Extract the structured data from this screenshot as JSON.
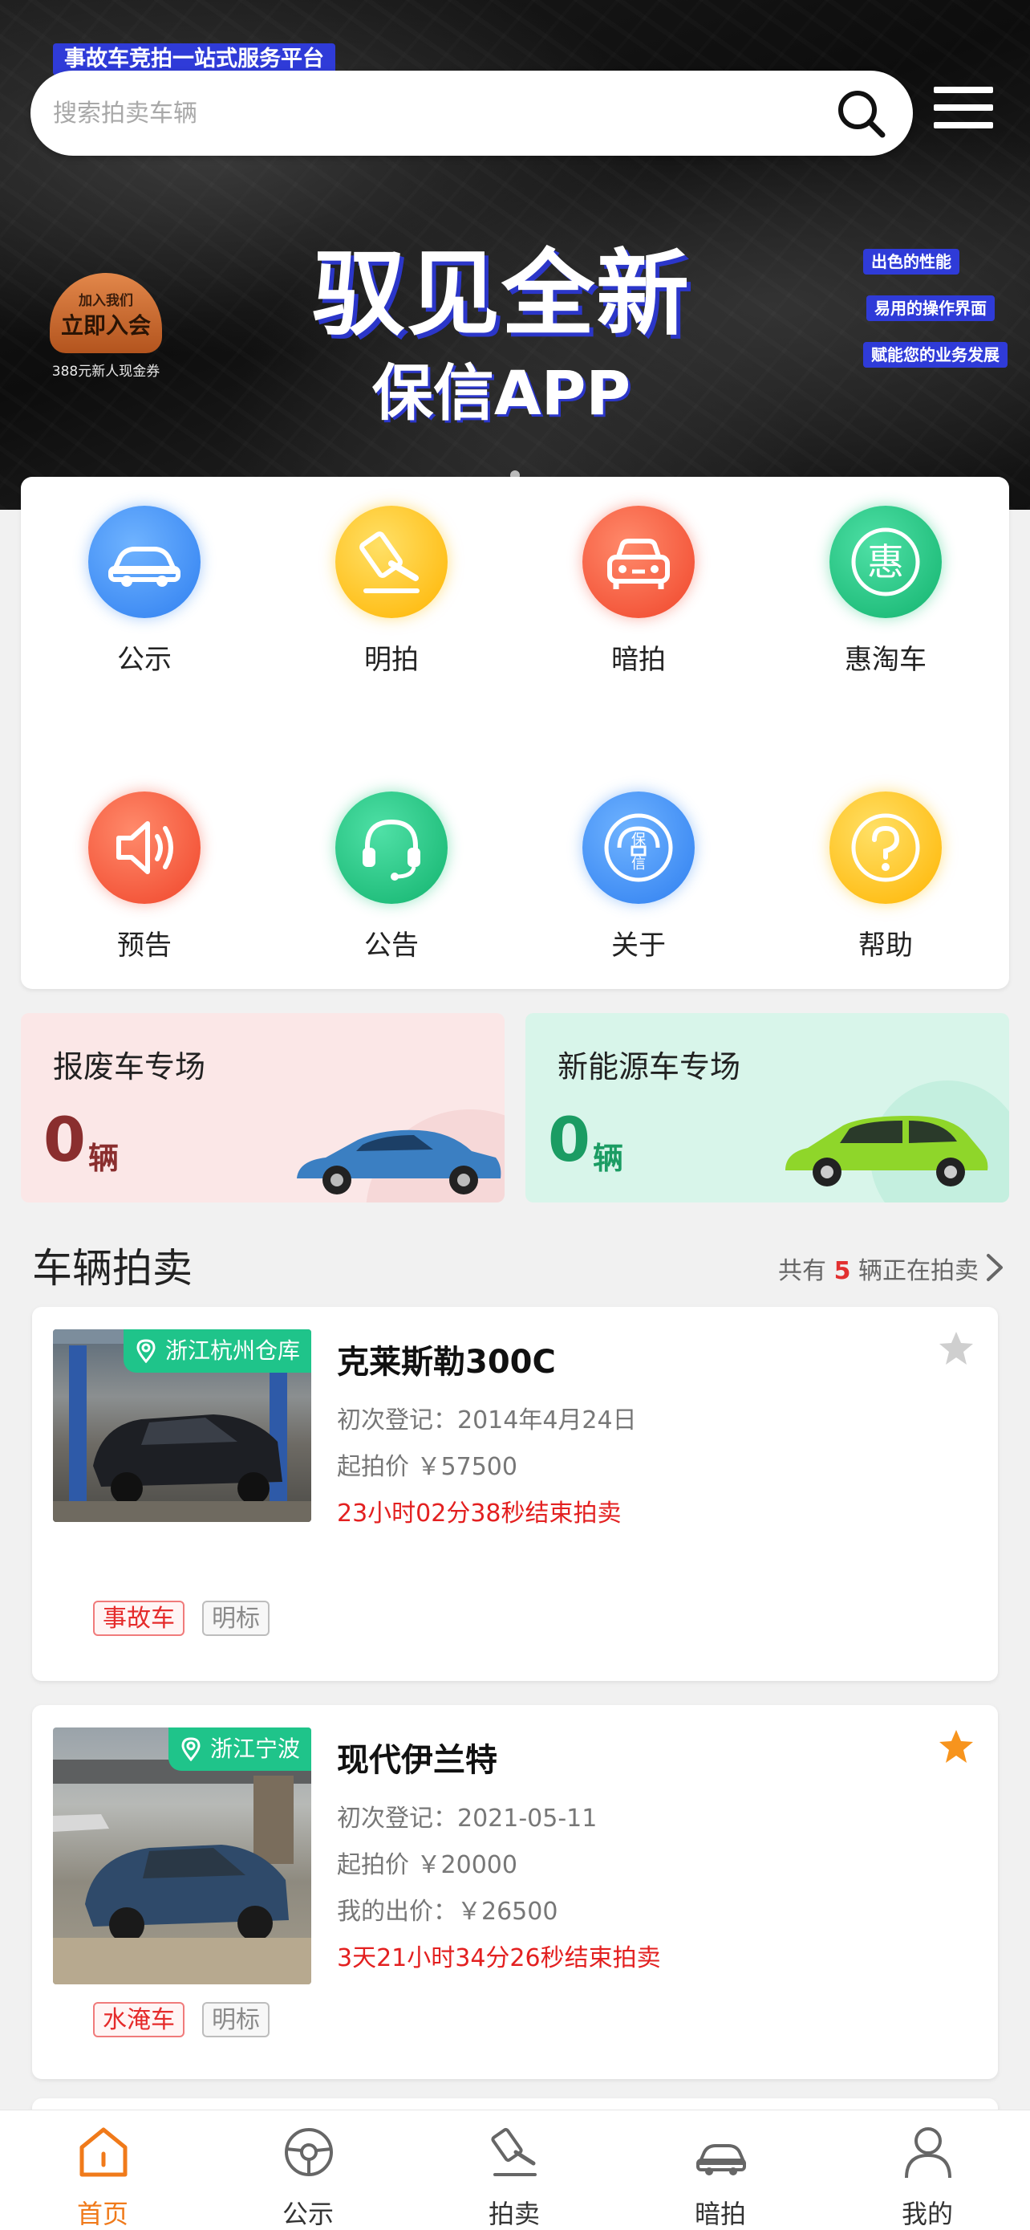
{
  "banner": {
    "tag": "事故车竞拍一站式服务平台",
    "search_placeholder": "搜索拍卖车辆",
    "join_line1": "加入我们",
    "join_line2": "立即入会",
    "join_line3": "388元新人现金券",
    "headline1": "驭见全新",
    "headline2": "保信APP",
    "features": [
      "出色的性能",
      "易用的操作界面",
      "赋能您的业务发展"
    ]
  },
  "categories": [
    {
      "label": "公示",
      "icon": "car-icon",
      "color": "#3d8ff5"
    },
    {
      "label": "明拍",
      "icon": "gavel-icon",
      "color": "#ffc51a"
    },
    {
      "label": "暗拍",
      "icon": "car-front-icon",
      "color": "#f5573e"
    },
    {
      "label": "惠淘车",
      "icon": "hui-icon",
      "color": "#1cc77f"
    },
    {
      "label": "预告",
      "icon": "speaker-icon",
      "color": "#f5573e"
    },
    {
      "label": "公告",
      "icon": "headset-icon",
      "color": "#1cc77f"
    },
    {
      "label": "关于",
      "icon": "baoxin-logo-icon",
      "color": "#3d8ff5"
    },
    {
      "label": "帮助",
      "icon": "question-icon",
      "color": "#ffc51a"
    }
  ],
  "zones": [
    {
      "title": "报废车专场",
      "count": "0",
      "unit": "辆",
      "num_color": "#8a2e2e",
      "bg": "#fbe7e7"
    },
    {
      "title": "新能源车专场",
      "count": "0",
      "unit": "辆",
      "num_color": "#1b9c63",
      "bg": "#d8f5ea"
    }
  ],
  "section": {
    "title": "车辆拍卖",
    "more_prefix": "共有",
    "more_count": "5",
    "more_suffix": "辆正在拍卖"
  },
  "listings": [
    {
      "location": "浙江杭州仓库",
      "name": "克莱斯勒300C",
      "reg": "初次登记：2014年4月24日",
      "start_price": "起拍价 ￥57500",
      "ends": "23小时02分38秒结束拍卖",
      "tags": [
        "事故车",
        "明标"
      ],
      "starred": false
    },
    {
      "location": "浙江宁波",
      "name": "现代伊兰特",
      "reg": "初次登记：2021-05-11",
      "start_price": "起拍价 ￥20000",
      "my_bid": "我的出价：￥26500",
      "ends": "3天21小时34分26秒结束拍卖",
      "tags": [
        "水淹车",
        "明标"
      ],
      "starred": true
    }
  ],
  "tabs": [
    {
      "label": "首页",
      "icon": "home-icon",
      "active": true
    },
    {
      "label": "公示",
      "icon": "steering-wheel-icon",
      "active": false
    },
    {
      "label": "拍卖",
      "icon": "gavel-icon",
      "active": false
    },
    {
      "label": "暗拍",
      "icon": "car-icon",
      "active": false
    },
    {
      "label": "我的",
      "icon": "user-icon",
      "active": false
    }
  ],
  "colors": {
    "accent": "#f07a1a",
    "danger": "#e32020",
    "badge_green": "#1fc48a",
    "star": "#f7941d"
  }
}
